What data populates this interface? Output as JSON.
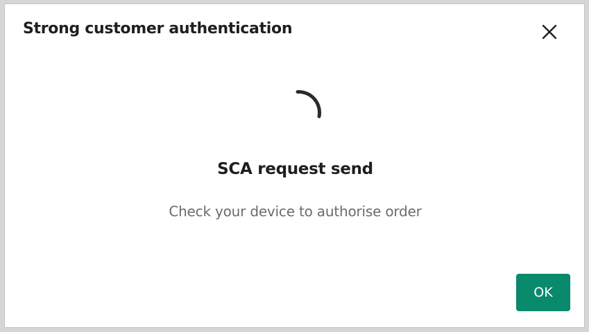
{
  "dialog": {
    "title": "Strong customer authentication",
    "close_icon": "close-icon"
  },
  "status": {
    "indicator_icon": "loading-spinner-icon",
    "title": "SCA request send",
    "message": "Check your device to authorise order"
  },
  "actions": {
    "ok_label": "OK"
  },
  "colors": {
    "primary_button": "#0a8a6c",
    "title_text": "#1f1f1f",
    "message_text": "#6b6b6b"
  }
}
